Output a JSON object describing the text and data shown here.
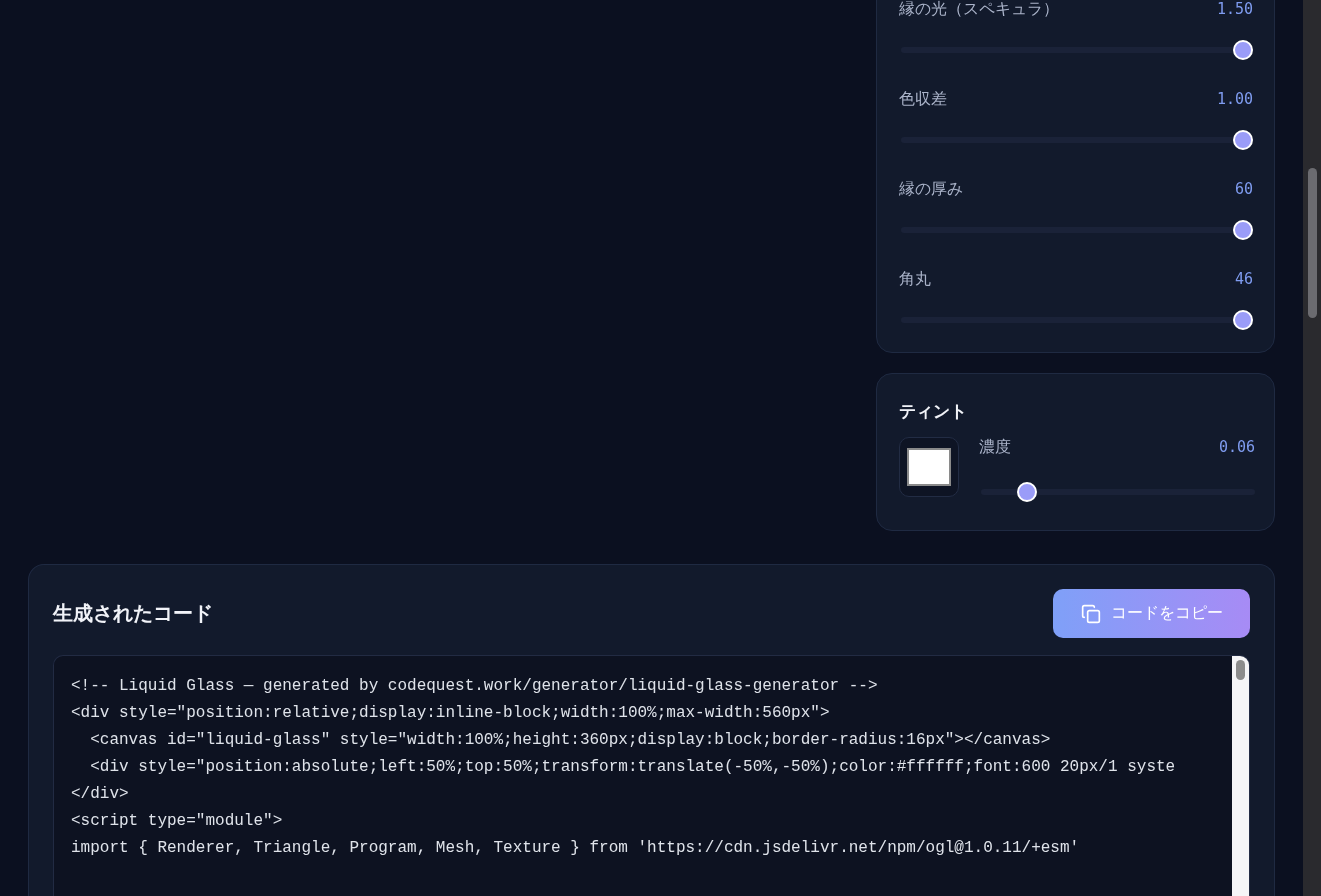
{
  "effect_panel": {
    "sliders": [
      {
        "label": "縁の光（スペキュラ）",
        "reading": "1.50",
        "level": 1
      },
      {
        "label": "色収差",
        "reading": "1.00",
        "level": 1
      },
      {
        "label": "縁の厚み",
        "reading": "60",
        "level": 1
      },
      {
        "label": "角丸",
        "reading": "46",
        "level": 1
      }
    ]
  },
  "tint_panel": {
    "title": "ティント",
    "swatch": {
      "color": "#ffffff"
    },
    "slider": {
      "label": "濃度",
      "reading": "0.06",
      "level": 0.15
    }
  },
  "code_panel": {
    "title": "生成されたコード",
    "copy_button": "コードをコピー",
    "lines": [
      "<!-- Liquid Glass — generated by codequest.work/generator/liquid-glass-generator -->",
      "<div style=\"position:relative;display:inline-block;width:100%;max-width:560px\">",
      "  <canvas id=\"liquid-glass\" style=\"width:100%;height:360px;display:block;border-radius:16px\"></canvas>",
      "  <div style=\"position:absolute;left:50%;top:50%;transform:translate(-50%,-50%);color:#ffffff;font:600 20px/1 syste",
      "</div>",
      "<script type=\"module\">",
      "import { Renderer, Triangle, Program, Mesh, Texture } from 'https://cdn.jsdelivr.net/npm/ogl@1.0.11/+esm'"
    ]
  }
}
